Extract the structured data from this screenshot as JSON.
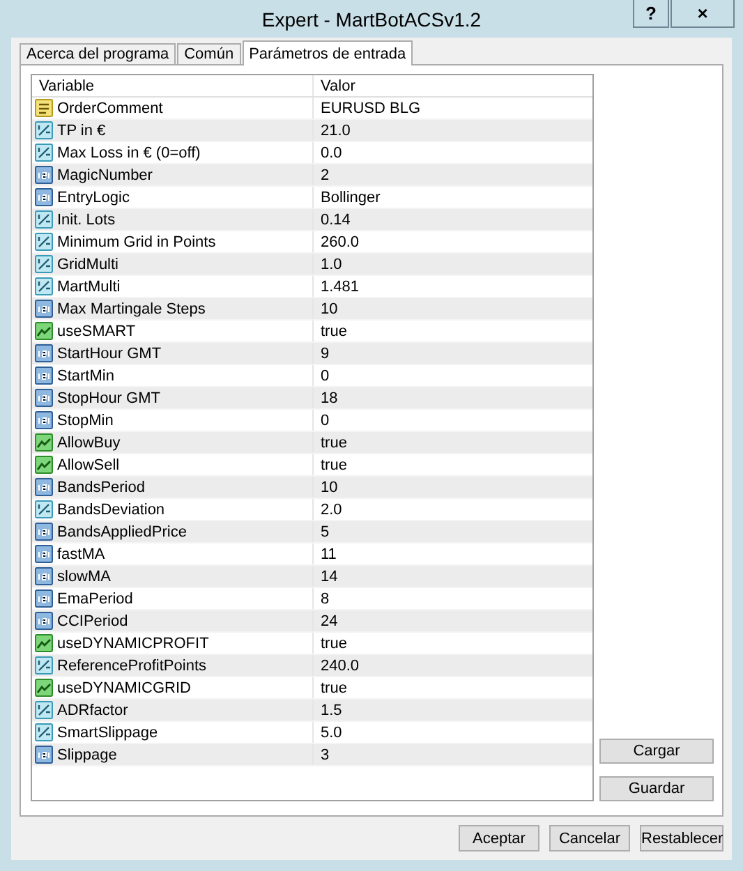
{
  "window": {
    "title": "Expert - MartBotACSv1.2",
    "help_button": "?",
    "close_button": "×"
  },
  "tabs": [
    {
      "label": "Acerca del programa",
      "selected": false
    },
    {
      "label": "Común",
      "selected": false
    },
    {
      "label": "Parámetros de entrada",
      "selected": true
    }
  ],
  "table": {
    "columns": [
      "Variable",
      "Valor"
    ],
    "rows": [
      {
        "kind": "string",
        "variable": "OrderComment",
        "value": "EURUSD BLG"
      },
      {
        "kind": "double",
        "variable": "TP in €",
        "value": "21.0"
      },
      {
        "kind": "double",
        "variable": "Max Loss in € (0=off)",
        "value": "0.0"
      },
      {
        "kind": "int",
        "variable": "MagicNumber",
        "value": "2"
      },
      {
        "kind": "int",
        "variable": "EntryLogic",
        "value": "Bollinger"
      },
      {
        "kind": "double",
        "variable": "Init. Lots",
        "value": "0.14"
      },
      {
        "kind": "double",
        "variable": "Minimum Grid in Points",
        "value": "260.0"
      },
      {
        "kind": "double",
        "variable": "GridMulti",
        "value": "1.0"
      },
      {
        "kind": "double",
        "variable": "MartMulti",
        "value": "1.481"
      },
      {
        "kind": "int",
        "variable": "Max Martingale Steps",
        "value": "10"
      },
      {
        "kind": "bool",
        "variable": "useSMART",
        "value": "true"
      },
      {
        "kind": "int",
        "variable": "StartHour GMT",
        "value": "9"
      },
      {
        "kind": "int",
        "variable": "StartMin",
        "value": "0"
      },
      {
        "kind": "int",
        "variable": "StopHour GMT",
        "value": "18"
      },
      {
        "kind": "int",
        "variable": "StopMin",
        "value": "0"
      },
      {
        "kind": "bool",
        "variable": "AllowBuy",
        "value": "true"
      },
      {
        "kind": "bool",
        "variable": "AllowSell",
        "value": "true"
      },
      {
        "kind": "int",
        "variable": "BandsPeriod",
        "value": "10"
      },
      {
        "kind": "double",
        "variable": "BandsDeviation",
        "value": "2.0"
      },
      {
        "kind": "int",
        "variable": "BandsAppliedPrice",
        "value": "5"
      },
      {
        "kind": "int",
        "variable": "fastMA",
        "value": "11"
      },
      {
        "kind": "int",
        "variable": "slowMA",
        "value": "14"
      },
      {
        "kind": "int",
        "variable": "EmaPeriod",
        "value": "8"
      },
      {
        "kind": "int",
        "variable": "CCIPeriod",
        "value": "24"
      },
      {
        "kind": "bool",
        "variable": "useDYNAMICPROFIT",
        "value": "true"
      },
      {
        "kind": "double",
        "variable": "ReferenceProfitPoints",
        "value": "240.0"
      },
      {
        "kind": "bool",
        "variable": "useDYNAMICGRID",
        "value": "true"
      },
      {
        "kind": "double",
        "variable": "ADRfactor",
        "value": "1.5"
      },
      {
        "kind": "double",
        "variable": "SmartSlippage",
        "value": "5.0"
      },
      {
        "kind": "int",
        "variable": "Slippage",
        "value": "3"
      }
    ]
  },
  "side_buttons": [
    "Cargar",
    "Guardar"
  ],
  "buttons": [
    "Aceptar",
    "Cancelar",
    "Restablecer"
  ]
}
